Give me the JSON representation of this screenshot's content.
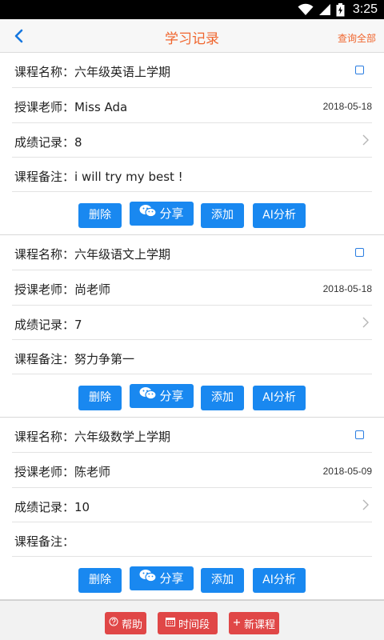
{
  "status_bar": {
    "time": "3:25"
  },
  "header": {
    "title": "学习记录",
    "query_all": "查询全部"
  },
  "records": [
    {
      "course_label": "课程名称：",
      "course": "六年级英语上学期",
      "teacher_label": "授课老师：",
      "teacher": "Miss Ada",
      "date": "2018-05-18",
      "score_label": "成绩记录：",
      "score": "8",
      "note_label": "课程备注：",
      "note": "i will try my best !"
    },
    {
      "course_label": "课程名称：",
      "course": "六年级语文上学期",
      "teacher_label": "授课老师：",
      "teacher": "尚老师",
      "date": "2018-05-18",
      "score_label": "成绩记录：",
      "score": "7",
      "note_label": "课程备注：",
      "note": "努力争第一"
    },
    {
      "course_label": "课程名称：",
      "course": "六年级数学上学期",
      "teacher_label": "授课老师：",
      "teacher": "陈老师",
      "date": "2018-05-09",
      "score_label": "成绩记录：",
      "score": "10",
      "note_label": "课程备注：",
      "note": ""
    }
  ],
  "actions": {
    "delete": "删除",
    "share": "分享",
    "add": "添加",
    "ai": "AI分析"
  },
  "bottom": {
    "help": "帮助",
    "time_range": "时间段",
    "new_course": "新课程"
  },
  "colors": {
    "accent": "#f0662e",
    "button_blue": "#1988f0",
    "bottom_red": "#e04747"
  },
  "icons": {
    "back": "chevron-left-icon",
    "share": "wechat-icon",
    "help": "question-icon",
    "time_range": "calendar-icon",
    "new_course": "plus-icon"
  }
}
